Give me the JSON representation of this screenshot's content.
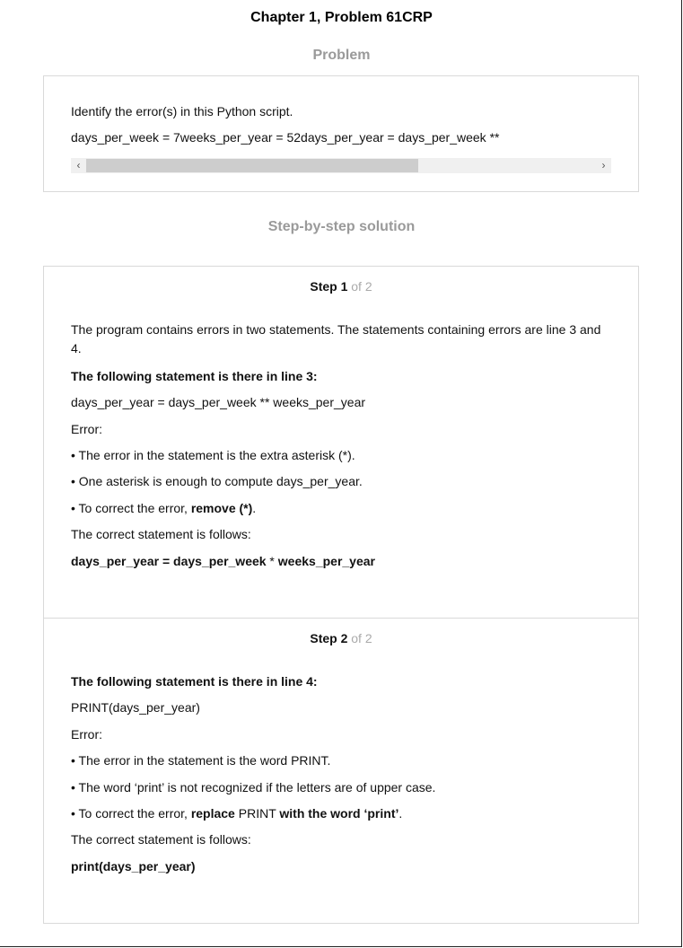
{
  "header": {
    "title": "Chapter 1, Problem 61CRP"
  },
  "problem": {
    "section_title": "Problem",
    "question": "Identify the error(s) in this Python script.",
    "code_line": "days_per_week = 7weeks_per_year = 52days_per_year = days_per_week **",
    "scroll_left": "‹",
    "scroll_right": "›"
  },
  "solution": {
    "section_title": "Step-by-step solution",
    "steps": [
      {
        "label": "Step 1",
        "of": "of 2",
        "intro": "The program contains errors in two statements. The statements containing errors are line 3 and 4.",
        "heading": "The following statement is there in line 3:",
        "statement": "days_per_year = days_per_week ** weeks_per_year",
        "error_label": "Error:",
        "bullet1": "• The error in the statement is the extra asterisk (*).",
        "bullet2": "• One asterisk is enough to compute days_per_year.",
        "bullet3_prefix": "• To correct the error, ",
        "bullet3_bold": "remove (*)",
        "bullet3_suffix": ".",
        "correct_label": "The correct statement is follows:",
        "correct_bold1": "days_per_year = days_per_week",
        "correct_mid": " * ",
        "correct_bold2": "weeks_per_year"
      },
      {
        "label": "Step 2",
        "of": "of 2",
        "heading": "The following statement is there in line 4:",
        "statement": "PRINT(days_per_year)",
        "error_label": "Error:",
        "bullet1": "• The error in the statement is the word PRINT.",
        "bullet2": "• The word ‘print’ is not recognized if the letters are of upper case.",
        "bullet3_prefix": "• To correct the error, ",
        "bullet3_bold1": "replace",
        "bullet3_mid": " PRINT ",
        "bullet3_bold2": "with the word ‘print’",
        "bullet3_suffix": ".",
        "correct_label": "The correct statement is follows:",
        "correct_code": "print(days_per_year)"
      }
    ]
  }
}
